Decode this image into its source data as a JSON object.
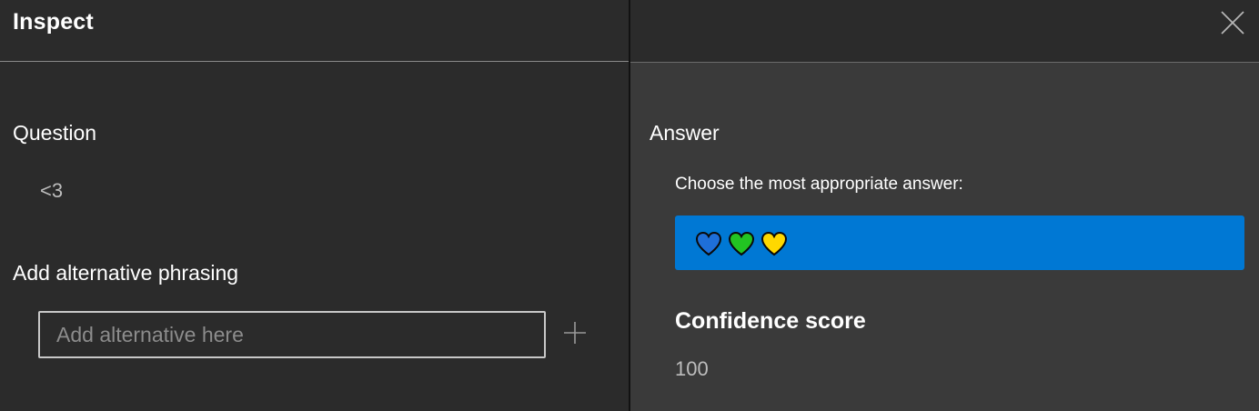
{
  "dialog": {
    "title": "Inspect",
    "close_icon": "close-icon"
  },
  "question": {
    "label": "Question",
    "value": "<3"
  },
  "alternative": {
    "label": "Add alternative phrasing",
    "placeholder": "Add alternative here",
    "add_icon": "plus-icon"
  },
  "answer": {
    "label": "Answer",
    "instruction": "Choose the most appropriate answer:",
    "option_icons": [
      "blue-heart-icon",
      "green-heart-icon",
      "yellow-heart-icon"
    ],
    "option_color": "#0078d4"
  },
  "confidence": {
    "label": "Confidence score",
    "value": "100"
  },
  "colors": {
    "background_left": "#2b2b2b",
    "background_right": "#3a3a3a",
    "accent": "#0078d4",
    "heart_blue": "#1e6fd9",
    "heart_green": "#22c422",
    "heart_yellow": "#ffd800"
  }
}
